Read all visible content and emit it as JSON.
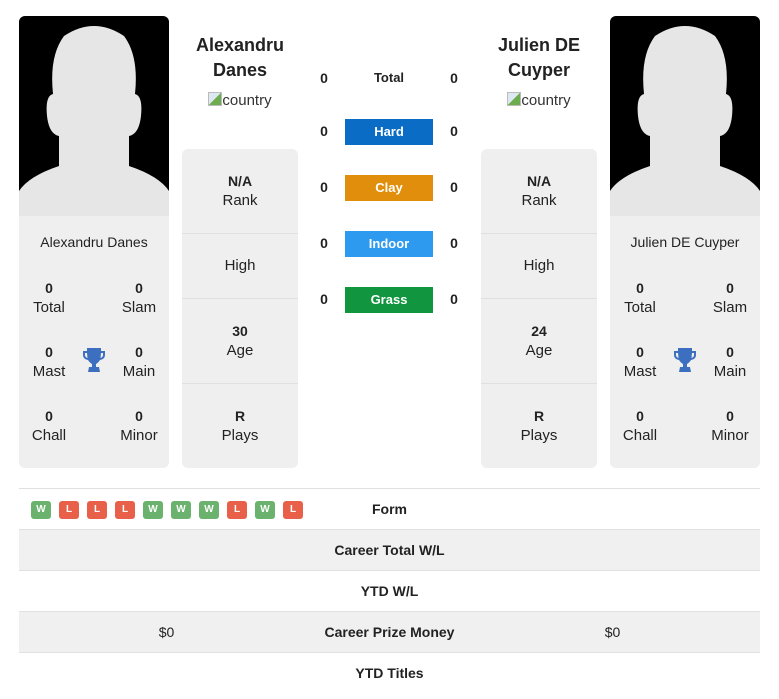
{
  "players": [
    {
      "name": "Alexandru Danes",
      "name_line1": "Alexandru",
      "name_line2": "Danes",
      "country_alt": "country",
      "card_name": "Alexandru Danes",
      "titles": {
        "total": "0",
        "slam": "0",
        "mast": "0",
        "main": "0",
        "chall": "0",
        "minor": "0"
      },
      "rank": "N/A",
      "high": "High",
      "age": "30",
      "plays": "R"
    },
    {
      "name": "Julien DE Cuyper",
      "name_line1": "Julien DE",
      "name_line2": "Cuyper",
      "country_alt": "country",
      "card_name": "Julien DE Cuyper",
      "titles": {
        "total": "0",
        "slam": "0",
        "mast": "0",
        "main": "0",
        "chall": "0",
        "minor": "0"
      },
      "rank": "N/A",
      "high": "High",
      "age": "24",
      "plays": "R"
    }
  ],
  "labels": {
    "total": "Total",
    "slam": "Slam",
    "mast": "Mast",
    "main": "Main",
    "chall": "Chall",
    "minor": "Minor",
    "rank": "Rank",
    "age": "Age",
    "plays": "Plays"
  },
  "surfaces": [
    {
      "label": "Total",
      "left": "0",
      "right": "0",
      "color": null
    },
    {
      "label": "Hard",
      "left": "0",
      "right": "0",
      "color": "#0a6cc4"
    },
    {
      "label": "Clay",
      "left": "0",
      "right": "0",
      "color": "#e08e0b"
    },
    {
      "label": "Indoor",
      "left": "0",
      "right": "0",
      "color": "#2d9af0"
    },
    {
      "label": "Grass",
      "left": "0",
      "right": "0",
      "color": "#11963f"
    }
  ],
  "form": [
    "W",
    "L",
    "L",
    "L",
    "W",
    "W",
    "W",
    "L",
    "W",
    "L"
  ],
  "form_colors": {
    "W": "#6ab26d",
    "L": "#e8604a"
  },
  "table": [
    {
      "label": "Form",
      "left": "",
      "right": ""
    },
    {
      "label": "Career Total W/L",
      "left": "",
      "right": ""
    },
    {
      "label": "YTD W/L",
      "left": "",
      "right": ""
    },
    {
      "label": "Career Prize Money",
      "left": "$0",
      "right": "$0"
    },
    {
      "label": "YTD Titles",
      "left": "",
      "right": ""
    }
  ]
}
